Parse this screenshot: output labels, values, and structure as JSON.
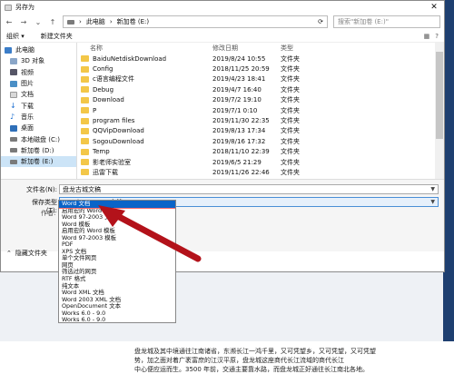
{
  "dialog": {
    "title": "另存为",
    "close_symbol": "✕"
  },
  "address": {
    "path": [
      "此电脑",
      "新加卷 (E:)"
    ],
    "search_placeholder": "搜索\"新加卷 (E:)\""
  },
  "toolbar": {
    "organize": "组织 ▾",
    "new_folder": "新建文件夹"
  },
  "nav": {
    "items": [
      {
        "label": "此电脑",
        "icon": "pc-icon"
      },
      {
        "label": "3D 对象",
        "icon": "cube-icon"
      },
      {
        "label": "视频",
        "icon": "video-icon"
      },
      {
        "label": "图片",
        "icon": "picture-icon"
      },
      {
        "label": "文档",
        "icon": "document-icon"
      },
      {
        "label": "下载",
        "icon": "download-icon"
      },
      {
        "label": "音乐",
        "icon": "music-icon"
      },
      {
        "label": "桌面",
        "icon": "desktop-icon"
      },
      {
        "label": "本地磁盘 (C:)",
        "icon": "drive-icon"
      },
      {
        "label": "新加卷 (D:)",
        "icon": "drive-icon"
      },
      {
        "label": "新加卷 (E:)",
        "icon": "drive-icon",
        "selected": true
      }
    ]
  },
  "files": {
    "columns": [
      "名称",
      "修改日期",
      "类型"
    ],
    "rows": [
      {
        "name": "BaiduNetdiskDownload",
        "date": "2019/8/24 10:55",
        "type": "文件夹"
      },
      {
        "name": "Config",
        "date": "2018/11/25 20:59",
        "type": "文件夹"
      },
      {
        "name": "c语言编程文件",
        "date": "2019/4/23 18:41",
        "type": "文件夹"
      },
      {
        "name": "Debug",
        "date": "2019/4/7 16:40",
        "type": "文件夹"
      },
      {
        "name": "Download",
        "date": "2019/7/2 19:10",
        "type": "文件夹"
      },
      {
        "name": "P",
        "date": "2019/7/1 0:10",
        "type": "文件夹"
      },
      {
        "name": "program files",
        "date": "2019/11/30 22:35",
        "type": "文件夹"
      },
      {
        "name": "QQVipDownload",
        "date": "2019/8/13 17:34",
        "type": "文件夹"
      },
      {
        "name": "SogouDownload",
        "date": "2019/8/16 17:32",
        "type": "文件夹"
      },
      {
        "name": "Temp",
        "date": "2018/11/10 22:39",
        "type": "文件夹"
      },
      {
        "name": "影老师实验室",
        "date": "2019/6/5 21:29",
        "type": "文件夹"
      },
      {
        "name": "迅雷下载",
        "date": "2019/11/26 22:46",
        "type": "文件夹"
      }
    ]
  },
  "form": {
    "filename_label": "文件名(N):",
    "filename_value": "盘龙古城文稿",
    "savetype_label": "保存类型(T):",
    "savetype_value": "Word 97-2003 文档",
    "author_label": "作者:",
    "hide_folders": "隐藏文件夹"
  },
  "dropdown": {
    "options": [
      "Word 文档",
      "启用宏的 Word 文档",
      "Word 97-2003 文档",
      "Word 模板",
      "启用宏的 Word 模板",
      "Word 97-2003 模板",
      "PDF",
      "XPS 文档",
      "单个文件网页",
      "网页",
      "筛选过的网页",
      "RTF 格式",
      "纯文本",
      "Word XML 文档",
      "Word 2003 XML 文档",
      "OpenDocument 文本",
      "Works 6.0 - 9.0",
      "Works 6.0 - 9.0"
    ],
    "highlighted_index": 0
  },
  "background": {
    "text_line1": "盘龙城及其中境通往江南诸省，东濒长江一鸿千里，又可凭望乡，又可凭望，又可凭望",
    "text_line2": "势，加之面对着广袤富庶的江汉平原，盘龙城这座商代长江流域的商代长江",
    "text_line3": "中心便应运而生。3500 年前，交通主要靠水路，而盘龙城正好通往长江南北各地。"
  },
  "colors": {
    "highlight": "#0a64c8",
    "arrow": "#b3121a",
    "selection": "#cce4f7"
  }
}
